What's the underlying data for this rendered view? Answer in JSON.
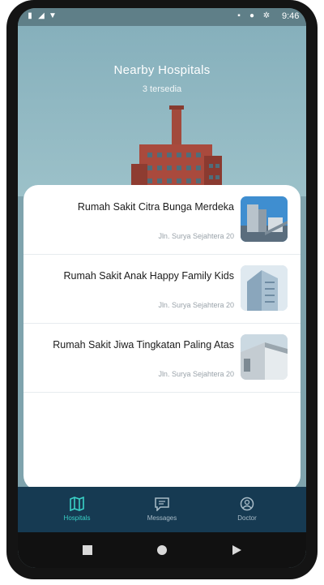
{
  "status_bar": {
    "time": "9:46",
    "icons": [
      "battery-icon",
      "signal-icon",
      "wifi-icon",
      "settings-icon",
      "circle-icon",
      "sd-card-icon"
    ]
  },
  "header": {
    "title": "Nearby Hospitals",
    "subtitle": "3 tersedia"
  },
  "hospitals": [
    {
      "name": "Rumah Sakit Citra Bunga Merdeka",
      "address": "Jln. Surya Sejahtera 20"
    },
    {
      "name": "Rumah Sakit Anak Happy Family Kids",
      "address": "Jln. Surya Sejahtera 20"
    },
    {
      "name": "Rumah Sakit Jiwa Tingkatan Paling Atas",
      "address": "Jln. Surya Sejahtera 20"
    }
  ],
  "bottom_nav": {
    "items": [
      {
        "label": "Hospitals",
        "icon": "map-icon",
        "active": true
      },
      {
        "label": "Messages",
        "icon": "message-icon",
        "active": false
      },
      {
        "label": "Doctor",
        "icon": "doctor-icon",
        "active": false
      }
    ]
  },
  "system_nav": {
    "icons": [
      "recents-icon",
      "home-icon",
      "back-icon"
    ]
  },
  "colors": {
    "hero": "#86b0bc",
    "nav_bg": "#163a52",
    "accent": "#3ad1c7"
  }
}
